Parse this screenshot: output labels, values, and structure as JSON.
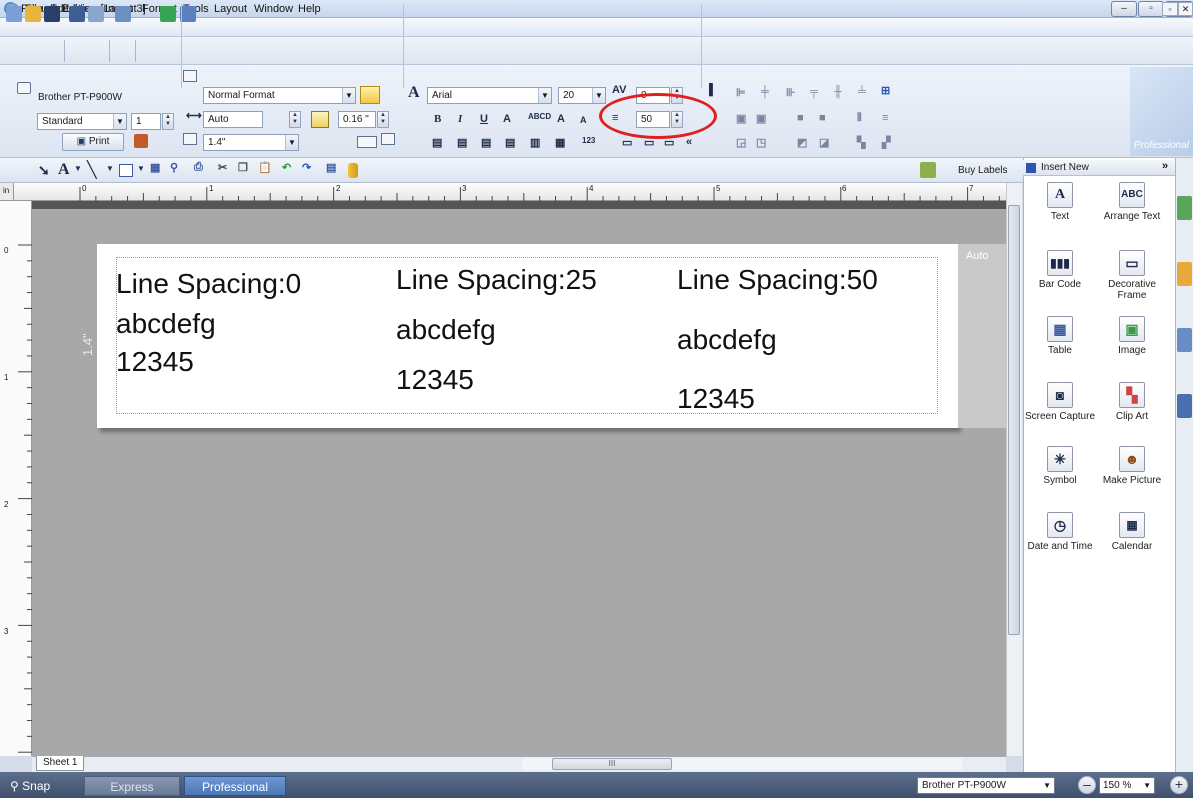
{
  "window": {
    "title": "P-touch Editor - [Layout3]"
  },
  "menu": {
    "items": [
      "File",
      "Edit",
      "View",
      "Insert",
      "Format",
      "Tools",
      "Layout",
      "Window",
      "Help"
    ]
  },
  "printer_group": {
    "printer": "Brother PT-P900W",
    "mode": "Standard",
    "copies": "1",
    "print_label": "Print"
  },
  "format_group": {
    "format": "Normal Format",
    "width": "Auto",
    "margin": "0.16 \"",
    "tape": "1.4\""
  },
  "font_group": {
    "font": "Arial",
    "size": "20",
    "char_spacing": "0",
    "line_spacing": "50"
  },
  "drawbar": {
    "buy_labels": "Buy Labels"
  },
  "ruler": {
    "unit": "in",
    "marks": [
      "0",
      "1",
      "2",
      "3",
      "4",
      "5",
      "6",
      "7"
    ],
    "vmarks": [
      "0",
      "1",
      "2",
      "3"
    ]
  },
  "label": {
    "side_text": "Auto",
    "length_text": "1.4\"",
    "columns": [
      {
        "title": "Line Spacing:0",
        "line1": "abcdefg",
        "line2": "12345"
      },
      {
        "title": "Line Spacing:25",
        "line1": "abcdefg",
        "line2": "12345"
      },
      {
        "title": "Line Spacing:50",
        "line1": "abcdefg",
        "line2": "12345"
      }
    ]
  },
  "sheet": {
    "tab": "Sheet 1"
  },
  "side_panel": {
    "header": "Insert New",
    "collapse": "»",
    "items": [
      {
        "label": "Text",
        "icon": "text-icon"
      },
      {
        "label": "Arrange Text",
        "icon": "arrange-text-icon"
      },
      {
        "label": "Bar Code",
        "icon": "barcode-icon"
      },
      {
        "label": "Decorative Frame",
        "icon": "frame-icon"
      },
      {
        "label": "Table",
        "icon": "table-icon"
      },
      {
        "label": "Image",
        "icon": "image-icon"
      },
      {
        "label": "Screen Capture",
        "icon": "screen-capture-icon"
      },
      {
        "label": "Clip Art",
        "icon": "clip-art-icon"
      },
      {
        "label": "Symbol",
        "icon": "symbol-icon"
      },
      {
        "label": "Make Picture",
        "icon": "make-picture-icon"
      },
      {
        "label": "Date and Time",
        "icon": "clock-icon"
      },
      {
        "label": "Calendar",
        "icon": "calendar-icon"
      }
    ]
  },
  "logo": {
    "text": "Professional"
  },
  "status": {
    "snap": "Snap",
    "express": "Express",
    "professional": "Professional",
    "printer": "Brother PT-P900W",
    "zoom": "150 %"
  },
  "colors": {
    "accent": "#4a76b6",
    "highlight": "#e02020"
  }
}
